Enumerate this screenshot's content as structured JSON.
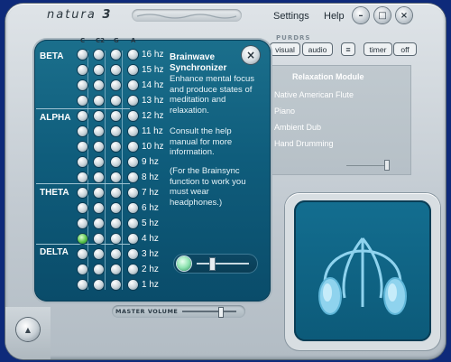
{
  "app": {
    "logo": "natura",
    "logo_num": "3"
  },
  "menu": {
    "settings": "Settings",
    "help": "Help"
  },
  "window_buttons": {
    "minimize": "–",
    "maximize": "□",
    "close": "×"
  },
  "columns": [
    "C",
    "C2",
    "G",
    "A"
  ],
  "bands": [
    "BETA",
    "ALPHA",
    "THETA",
    "DELTA"
  ],
  "frequencies": [
    "16 hz",
    "15 hz",
    "14 hz",
    "13 hz",
    "12 hz",
    "11 hz",
    "10 hz",
    "9 hz",
    "8 hz",
    "7 hz",
    "6 hz",
    "5 hz",
    "4 hz",
    "3 hz",
    "2 hz",
    "1 hz"
  ],
  "selected_frequency": "4 hz",
  "help": {
    "title": "Brainwave Synchronizer",
    "p1": "Enhance mental focus and produce states of meditation and relaxation.",
    "p2": "Consult the help manual for more information.",
    "p3": "(For the Brainsync function to work you must wear headphones.)",
    "close": "×"
  },
  "master_volume": {
    "label": "MASTER VOLUME",
    "level": 0.73
  },
  "sync_slider": {
    "level": 0.25
  },
  "right": {
    "header": "PURDRS",
    "visual": "visual",
    "audio": "audio",
    "timer": "timer",
    "timer_value": "off"
  },
  "relaxation": {
    "title": "Relaxation Module",
    "items": [
      "Native American Flute",
      "Piano",
      "Ambient Dub",
      "Hand Drumming"
    ],
    "slider_level": 0.87
  },
  "colors": {
    "panel": "#0f5d7c",
    "accent": "#59c24a",
    "background": "#0e2a7a"
  },
  "icons": {
    "viewer": "headphones-icon"
  }
}
